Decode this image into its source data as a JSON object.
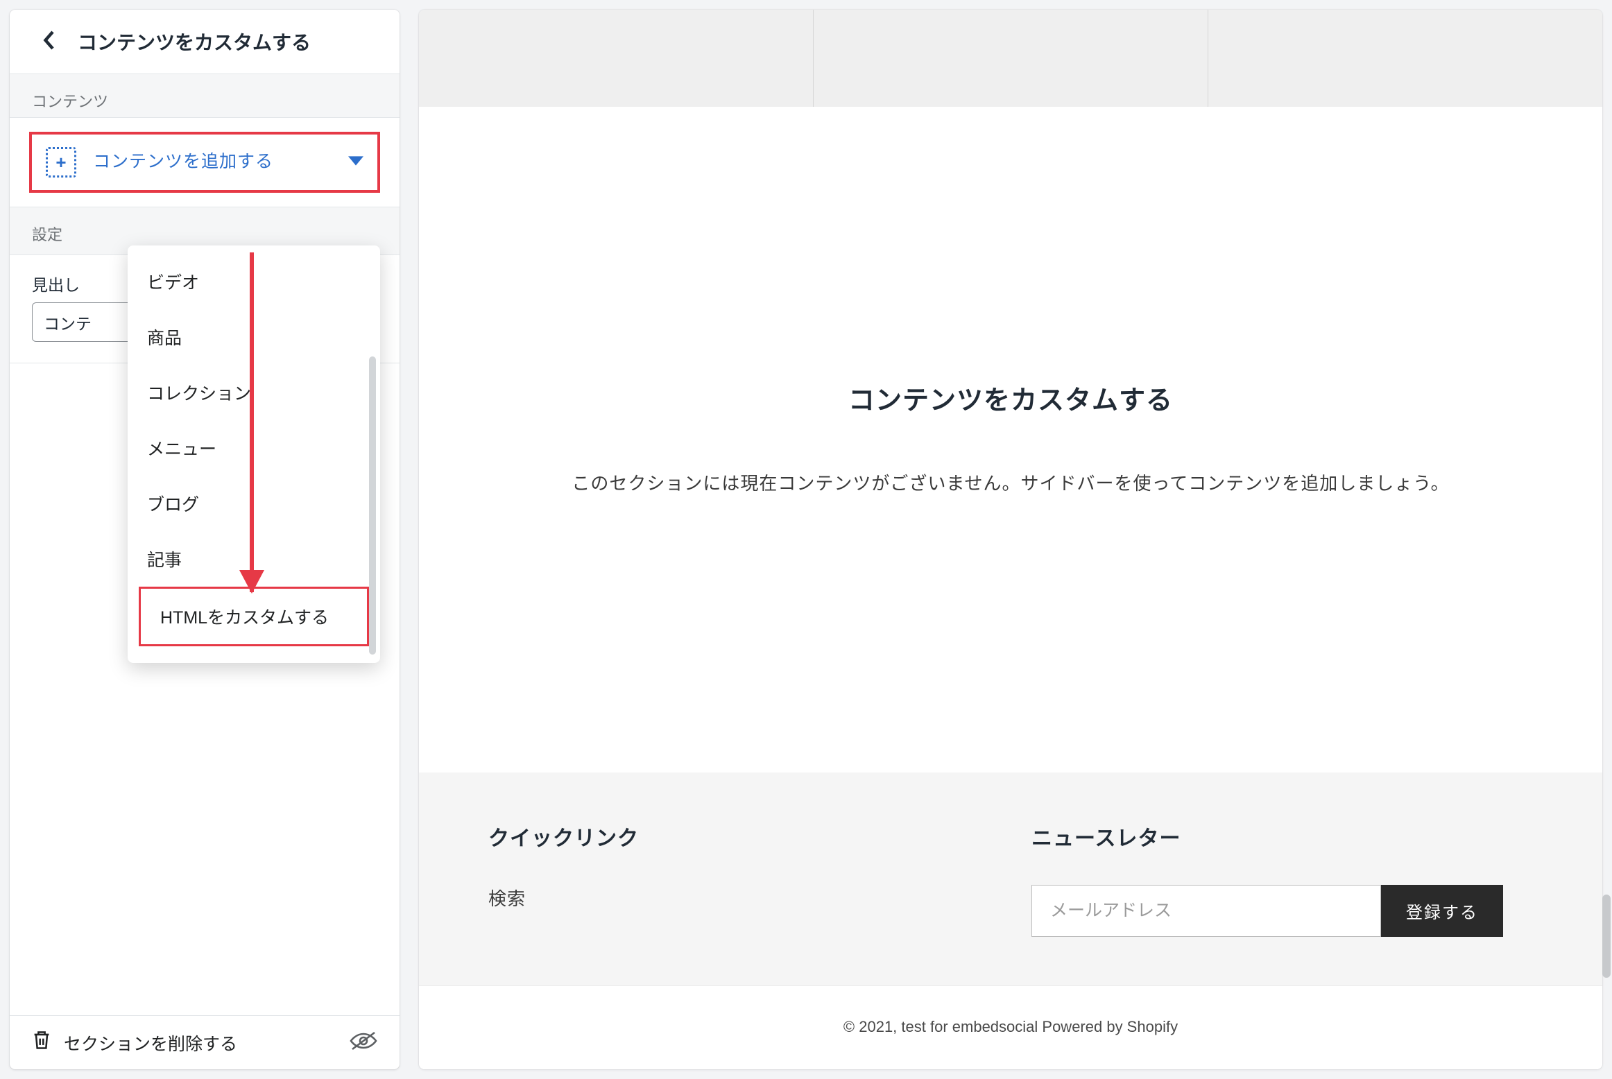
{
  "sidebar": {
    "title": "コンテンツをカスタムする",
    "sections": {
      "content_label": "コンテンツ",
      "add_block_label": "コンテンツを追加する",
      "settings_label": "設定",
      "heading_field_label": "見出し",
      "heading_field_value": "コンテ"
    },
    "dropdown": {
      "items": [
        "ビデオ",
        "商品",
        "コレクション",
        "メニュー",
        "ブログ",
        "記事",
        "HTMLをカスタムする"
      ]
    },
    "footer": {
      "delete_label": "セクションを削除する"
    }
  },
  "preview": {
    "hero_title": "コンテンツをカスタムする",
    "hero_sub": "このセクションには現在コンテンツがございません。サイドバーを使ってコンテンツを追加しましょう。",
    "footer": {
      "col1_title": "クイックリンク",
      "col1_link": "検索",
      "col2_title": "ニュースレター",
      "email_placeholder": "メールアドレス",
      "subscribe_label": "登録する"
    },
    "copyright": "© 2021, test for embedsocial Powered by Shopify"
  }
}
